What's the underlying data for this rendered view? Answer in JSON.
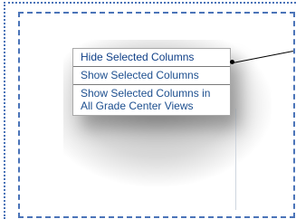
{
  "menu": {
    "items": [
      {
        "label": "Hide Selected Columns"
      },
      {
        "label": "Show Selected Columns"
      },
      {
        "label": "Show Selected Columns in All Grade Center Views"
      }
    ]
  }
}
